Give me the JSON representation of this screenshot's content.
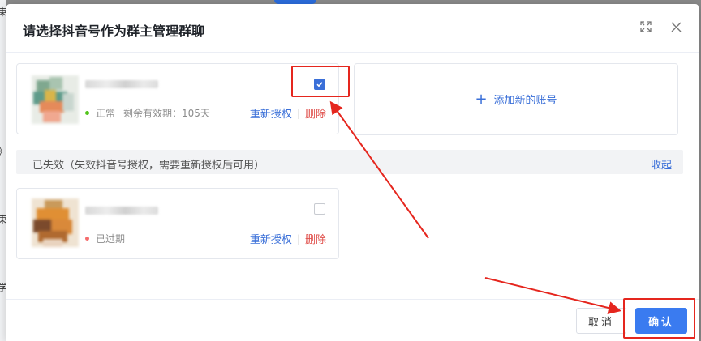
{
  "dialog": {
    "title": "请选择抖音号作为群主管理群聊"
  },
  "accounts": {
    "active": {
      "status": "正常",
      "validity": "剩余有效期：105天",
      "reauth": "重新授权",
      "delete": "删除",
      "checked": true,
      "status_color": "#52c41a"
    },
    "expired": {
      "status": "已过期",
      "reauth": "重新授权",
      "delete": "删除",
      "checked": false,
      "status_color": "#f56c6c"
    }
  },
  "add_account": {
    "label": "添加新的账号"
  },
  "expired_section": {
    "text": "已失效（失效抖音号授权，需要重新授权后可用）",
    "collapse": "收起"
  },
  "footer": {
    "cancel": "取消",
    "confirm": "确认"
  },
  "icons": {
    "expand": "fullscreen-icon",
    "close": "close-icon",
    "add": "plus-icon",
    "check": "check-icon"
  },
  "colors": {
    "primary": "#3a7bf0",
    "danger": "#e0524e",
    "annotation": "#e5261e"
  }
}
